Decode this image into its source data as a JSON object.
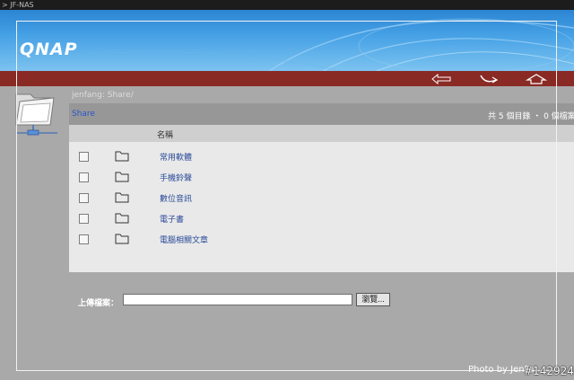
{
  "window": {
    "title": "> JF-NAS"
  },
  "brand": {
    "logo_text": "QNAP"
  },
  "nav": {
    "back_icon": "left-arrow-icon",
    "refresh_icon": "return-icon",
    "home_icon": "home-icon"
  },
  "breadcrumb": {
    "path": "jenfang: Share/"
  },
  "share_bar": {
    "share_link": "Share",
    "summary": "共 5 個目錄 ・ 0 個檔案"
  },
  "table": {
    "column_name": "名稱",
    "rows": [
      {
        "name": "常用軟體"
      },
      {
        "name": "手機鈴聲"
      },
      {
        "name": "數位音訊"
      },
      {
        "name": "電子書"
      },
      {
        "name": "電腦相關文章"
      }
    ]
  },
  "upload": {
    "label": "上傳檔案：",
    "value": "",
    "browse_label": "瀏覽..."
  },
  "credit": {
    "text": "Photo by JenFa"
  },
  "watermark": {
    "text": "#142924"
  },
  "colors": {
    "banner": "#3a94dc",
    "navbar": "#8a2a25",
    "panel": "#e9e9e9",
    "link": "#2c56c8"
  }
}
